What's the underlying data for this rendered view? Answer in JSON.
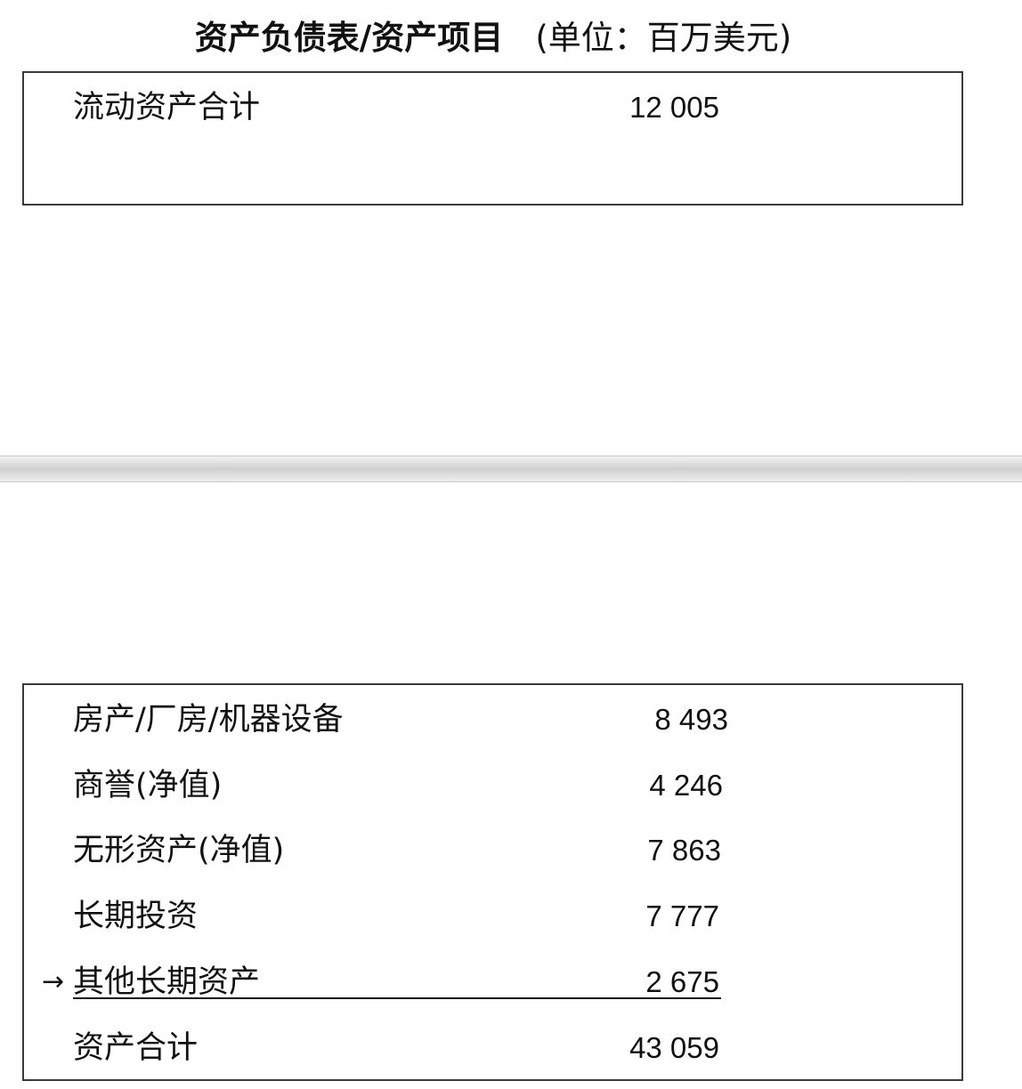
{
  "header": {
    "title": "资产负债表/资产项目",
    "unit": "(单位：百万美元)"
  },
  "top_table": {
    "rows": [
      {
        "label": "流动资产合计",
        "value": "12 005"
      }
    ]
  },
  "bottom_table": {
    "rows": [
      {
        "label": "房产/厂房/机器设备",
        "value": "8 493"
      },
      {
        "label": "商誉(净值)",
        "value": "4 246"
      },
      {
        "label": "无形资产(净值)",
        "value": "7 863"
      },
      {
        "label": "长期投资",
        "value": "7 777"
      },
      {
        "label": "其他长期资产",
        "value": "2 675",
        "marker": "→"
      },
      {
        "label": "资产合计",
        "value": "43 059"
      }
    ]
  }
}
